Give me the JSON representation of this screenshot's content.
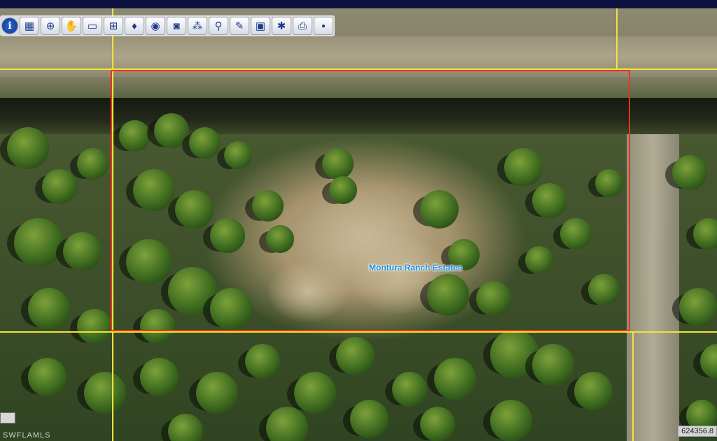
{
  "map": {
    "label": "Montura Ranch Estates",
    "parcel_color": "#f0321e",
    "grid_color": "#f1e33a"
  },
  "toolbar": {
    "tools": [
      {
        "name": "info-tool",
        "icon": "info-icon",
        "glyph": "i"
      },
      {
        "name": "select-tool",
        "icon": "select-area-icon",
        "glyph": "▦"
      },
      {
        "name": "zoom-in-tool",
        "icon": "zoom-in-icon",
        "glyph": "⊕"
      },
      {
        "name": "pan-tool",
        "icon": "hand-icon",
        "glyph": "✋"
      },
      {
        "name": "eraser-tool",
        "icon": "eraser-icon",
        "glyph": "▭"
      },
      {
        "name": "zoom-extent-tool",
        "icon": "map-extent-icon",
        "glyph": "⊞"
      },
      {
        "name": "marker-tool",
        "icon": "marker-icon",
        "glyph": "♦"
      },
      {
        "name": "layers-tool",
        "icon": "layers-icon",
        "glyph": "◉"
      },
      {
        "name": "photo-tool",
        "icon": "camera-icon",
        "glyph": "◙"
      },
      {
        "name": "network-tool",
        "icon": "network-icon",
        "glyph": "⁂"
      },
      {
        "name": "search-tool",
        "icon": "magnifier-icon",
        "glyph": "⚲"
      },
      {
        "name": "draw-tool",
        "icon": "pencil-icon",
        "glyph": "✎"
      },
      {
        "name": "print-map-tool",
        "icon": "monitor-icon",
        "glyph": "▣"
      },
      {
        "name": "settings-tool",
        "icon": "gears-icon",
        "glyph": "✱"
      },
      {
        "name": "print-tool",
        "icon": "printer-icon",
        "glyph": "⎙"
      },
      {
        "name": "save-tool",
        "icon": "floppy-disk-icon",
        "glyph": "▪"
      }
    ]
  },
  "footer": {
    "watermark": "SWFLAMLS",
    "coordinate": "624356.8"
  }
}
